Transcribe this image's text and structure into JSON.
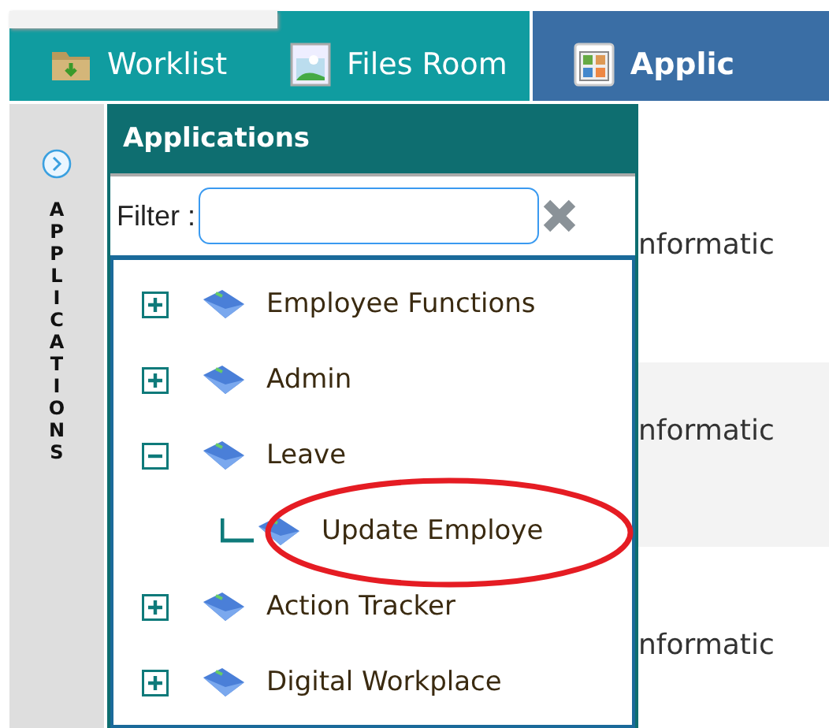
{
  "tabs": [
    {
      "label": "Worklist",
      "selected": false
    },
    {
      "label": "Files Room",
      "selected": false
    },
    {
      "label": "Applic",
      "selected": true
    }
  ],
  "side_strip": {
    "label": "APPLICATIONS"
  },
  "panel": {
    "title": "Applications",
    "filter": {
      "label": "Filter :"
    },
    "tree": [
      {
        "label": "Employee Functions",
        "expanded": false
      },
      {
        "label": "Admin",
        "expanded": false
      },
      {
        "label": "Leave",
        "expanded": true,
        "children": [
          {
            "label": "Update Employe"
          }
        ]
      },
      {
        "label": "Action Tracker",
        "expanded": false
      },
      {
        "label": "Digital Workplace",
        "expanded": false
      }
    ]
  },
  "background_rows": [
    {
      "text": "nformatic",
      "shaded": false
    },
    {
      "text": "nformatic",
      "shaded": true
    },
    {
      "text": "nformatic",
      "shaded": false
    }
  ],
  "annotation": {
    "kind": "ellipse"
  }
}
